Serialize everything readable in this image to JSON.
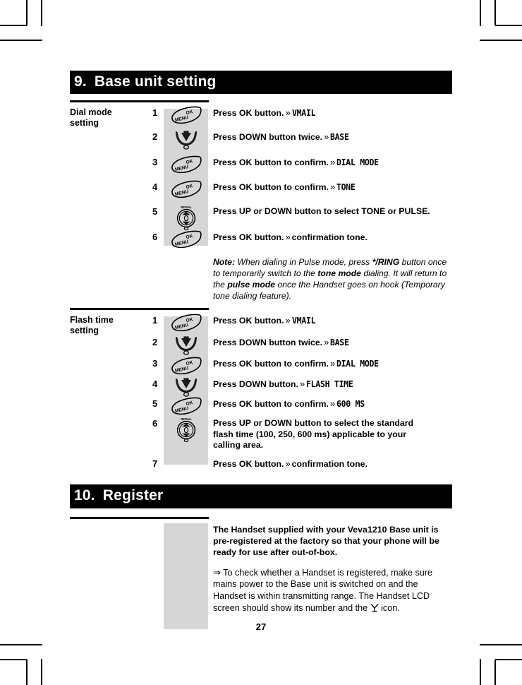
{
  "page": {
    "number": "27"
  },
  "sections": [
    {
      "id": "base-unit-setting",
      "number": "9.",
      "title": "Base unit setting",
      "procedures": [
        {
          "id": "dial-mode-setting",
          "title": "Dial mode\nsetting",
          "title_line1": "Dial mode",
          "title_line2": "setting",
          "steps": [
            {
              "num": "1",
              "icon": "ok-menu-button-icon",
              "text": "Press OK button.",
              "guillemet": "»",
              "lcd": "VMAIL"
            },
            {
              "num": "2",
              "icon": "down-button-icon",
              "text": "Press DOWN button twice.",
              "guillemet": "»",
              "lcd": "BASE"
            },
            {
              "num": "3",
              "icon": "ok-menu-button-icon",
              "text": "Press OK button to confirm.",
              "guillemet": "»",
              "lcd": "DIAL MODE"
            },
            {
              "num": "4",
              "icon": "ok-menu-button-icon",
              "text": "Press OK button to confirm.",
              "guillemet": "»",
              "lcd": "TONE"
            },
            {
              "num": "5",
              "icon": "up-down-wheel-icon",
              "text": "Press UP or DOWN button to select TONE or PULSE.",
              "guillemet": "",
              "lcd": ""
            },
            {
              "num": "6",
              "icon": "ok-menu-button-icon",
              "text": "Press OK button.",
              "guillemet": "»",
              "lcd_plain": "confirmation tone."
            }
          ],
          "note": {
            "label": "Note:",
            "part1": " When dialing in Pulse mode, press ",
            "bold1": "*/RING",
            "part2": " button once to temporarily switch to the ",
            "bold2": "tone mode",
            "part3": " dialing. It will return to the ",
            "bold3": "pulse mode",
            "part4": " once the Handset goes on hook (Temporary tone dialing feature)."
          }
        },
        {
          "id": "flash-time-setting",
          "title_line1": "Flash time",
          "title_line2": "setting",
          "steps": [
            {
              "num": "1",
              "icon": "ok-menu-button-icon",
              "text": "Press OK button.",
              "guillemet": "»",
              "lcd": "VMAIL"
            },
            {
              "num": "2",
              "icon": "down-button-icon",
              "text": "Press DOWN button twice.",
              "guillemet": "»",
              "lcd": "BASE"
            },
            {
              "num": "3",
              "icon": "ok-menu-button-icon",
              "text": "Press OK button to confirm.",
              "guillemet": "»",
              "lcd": "DIAL MODE"
            },
            {
              "num": "4",
              "icon": "down-button-icon",
              "text": "Press DOWN button.",
              "guillemet": "»",
              "lcd": "FLASH TIME"
            },
            {
              "num": "5",
              "icon": "ok-menu-button-icon",
              "text": "Press OK button to confirm.",
              "guillemet": "»",
              "lcd": "600 MS"
            },
            {
              "num": "6",
              "icon": "up-down-wheel-icon",
              "text": "Press UP or DOWN button to select the standard flash time (100, 250, 600 ms) applicable to your calling area.",
              "guillemet": "",
              "lcd": ""
            },
            {
              "num": "7",
              "icon": "none",
              "text": "Press OK button.",
              "guillemet": "»",
              "lcd_plain": "confirmation tone."
            }
          ]
        }
      ]
    },
    {
      "id": "register",
      "number": "10.",
      "title": "Register",
      "register": {
        "paragraph1_plain": "The Handset supplied with your Veva1210 Base unit is pre-registered at the factory ",
        "paragraph1_bold": "so that your phone will be ready for use after out-of-box.",
        "arrow": "⇒",
        "paragraph2_a": " To check whether a Handset is registered, make sure mains power to the Base unit is switched on and the  Handset is within transmitting range. The Handset LCD screen should show its number and the ",
        "antenna_icon": "antenna-icon",
        "paragraph2_b": " icon."
      }
    }
  ],
  "colors": {
    "header_bg": "#000000",
    "header_text": "#ffffff",
    "gray_band": "#d6d6d6",
    "page_bg": "#ffffff"
  }
}
